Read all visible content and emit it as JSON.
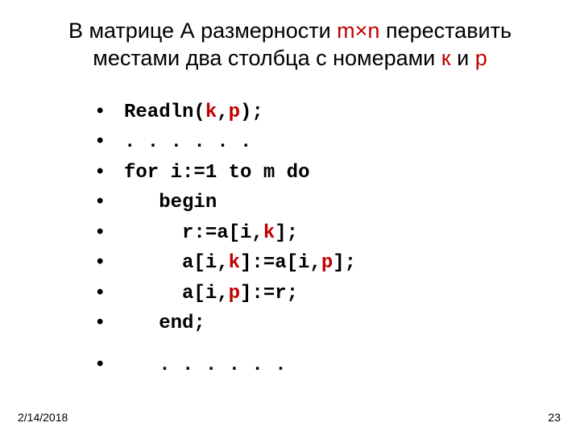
{
  "title": {
    "t1": "В матрице А размерности ",
    "dim": "m×n",
    "t2": " переставить местами два столбца с номерами ",
    "k": "к",
    "and": " и ",
    "p": "р"
  },
  "bullet": "•",
  "code": {
    "l1a": "Readln(",
    "l1k": "k",
    "l1c": ",",
    "l1p": "p",
    "l1b": ");",
    "l2": ". . . . . .",
    "l3a": "for",
    "l3b": " i:=1 ",
    "l3c": "to",
    "l3d": " m ",
    "l3e": "do",
    "l4": "   begin",
    "l5a": "     r:=a[i,",
    "l5k": "k",
    "l5b": "];",
    "l6a": "     a[i,",
    "l6k": "k",
    "l6b": "]:=a[i,",
    "l6p": "p",
    "l6c": "];",
    "l7a": "     a[i,",
    "l7p": "p",
    "l7b": "]:=r;",
    "l8": "   end;",
    "l9": "   . . . . . ."
  },
  "footer": {
    "date": "2/14/2018",
    "page": "23"
  }
}
